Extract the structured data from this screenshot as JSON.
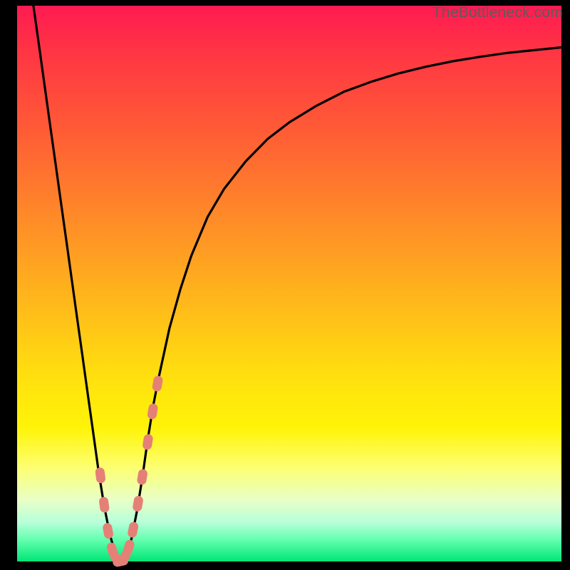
{
  "watermark": "TheBottleneck.com",
  "colors": {
    "curve_stroke": "#000000",
    "marker_fill": "#e58077",
    "marker_stroke": "#b85a52",
    "frame": "#000000"
  },
  "chart_data": {
    "type": "line",
    "title": "",
    "xlabel": "",
    "ylabel": "",
    "xlim": [
      0,
      100
    ],
    "ylim": [
      0,
      100
    ],
    "grid": false,
    "legend": false,
    "series": [
      {
        "name": "bottleneck-curve",
        "x": [
          3,
          4,
          5,
          6,
          7,
          8,
          9,
          10,
          11,
          12,
          13,
          14,
          15,
          16,
          17,
          18,
          19,
          20,
          21,
          22,
          23,
          24,
          25,
          26,
          28,
          30,
          32,
          35,
          38,
          42,
          46,
          50,
          55,
          60,
          65,
          70,
          75,
          80,
          85,
          90,
          95,
          100
        ],
        "y": [
          100,
          93,
          86,
          79,
          72,
          65,
          58,
          51,
          44,
          37,
          30,
          23,
          16,
          10,
          5,
          1.5,
          0,
          1,
          4,
          9,
          15,
          22,
          28,
          33,
          42,
          49,
          55,
          62,
          67,
          72,
          76,
          79,
          82,
          84.5,
          86.3,
          87.8,
          89,
          90,
          90.8,
          91.5,
          92,
          92.5
        ]
      }
    ],
    "markers": {
      "name": "highlighted-range",
      "x": [
        15.3,
        16.0,
        16.7,
        17.5,
        18.3,
        19.0,
        19.7,
        20.5,
        21.3,
        22.2,
        23.0,
        24.0,
        24.9,
        25.8
      ],
      "y": [
        15.5,
        10.2,
        5.5,
        2.0,
        0.4,
        0.0,
        0.7,
        2.5,
        5.7,
        10.4,
        15.2,
        21.5,
        27.0,
        32.0
      ]
    }
  }
}
